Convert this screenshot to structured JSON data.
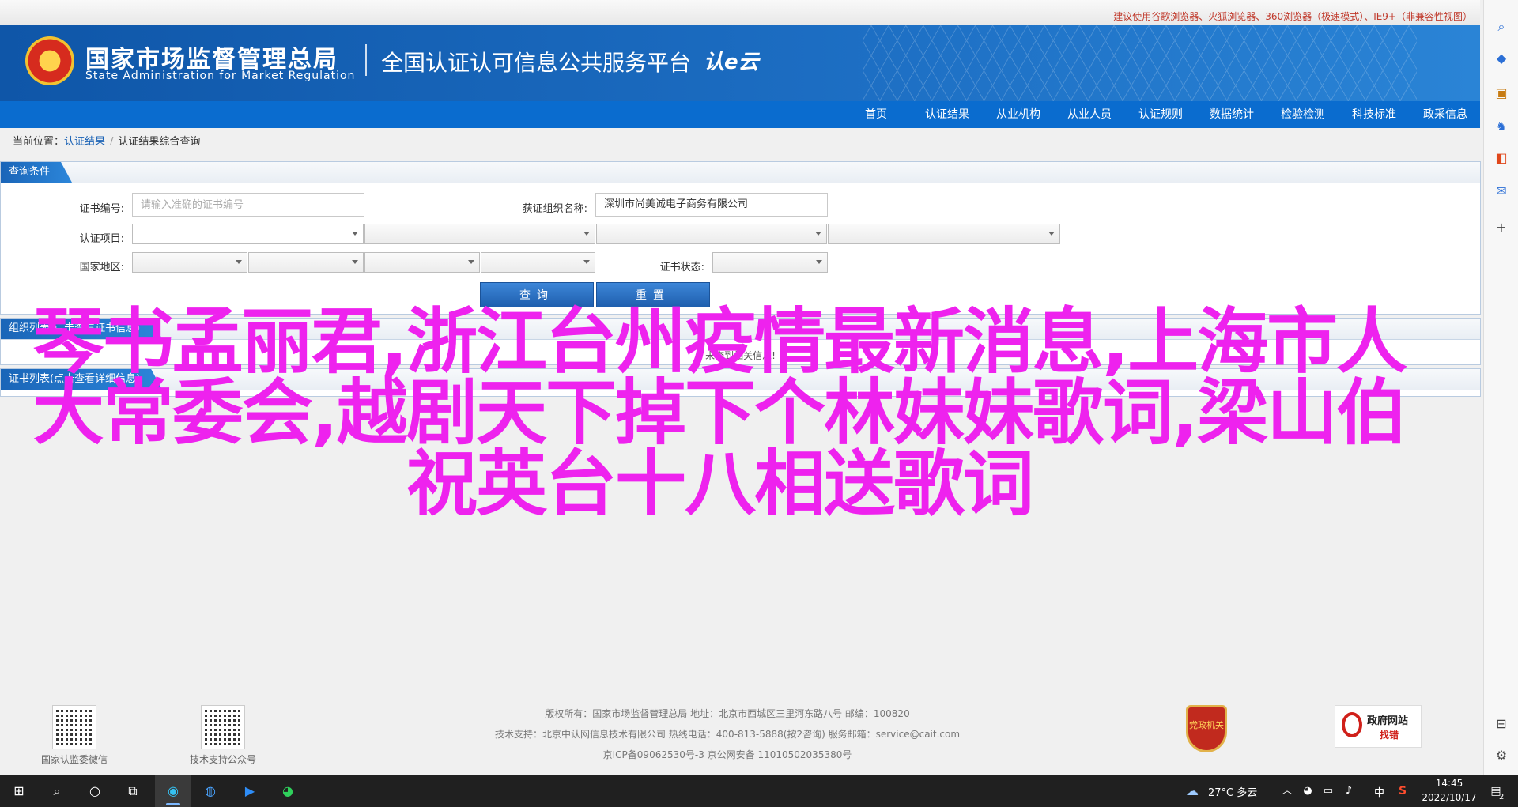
{
  "topbar": {
    "notice": "建议使用谷歌浏览器、火狐浏览器、360浏览器（极速模式）、IE9+（非兼容性视图）"
  },
  "header": {
    "agency_cn": "国家市场监督管理总局",
    "agency_en": "State Administration  for  Market Regulation",
    "platform": "全国认证认可信息公共服务平台",
    "cert_logo": "认e云"
  },
  "nav": {
    "items": [
      "首页",
      "认证结果",
      "从业机构",
      "从业人员",
      "认证规则",
      "数据统计",
      "检验检测",
      "科技标准",
      "政采信息"
    ]
  },
  "breadcrumb": {
    "label": "当前位置：",
    "link": "认证结果",
    "sep": "/",
    "current": "认证结果综合查询"
  },
  "query": {
    "tab": "查询条件",
    "cert_no_label": "证书编号:",
    "cert_no_placeholder": "请输入准确的证书编号",
    "org_label": "获证组织名称:",
    "org_value": "深圳市尚美诚电子商务有限公司",
    "project_label": "认证项目:",
    "region_label": "国家地区:",
    "status_label": "证书状态:",
    "search_button": "查询",
    "reset_button": "重置"
  },
  "org_list": {
    "tab": "组织列表(点击查看证书信息)",
    "empty": "未查到相关信息!"
  },
  "cert_list": {
    "tab": "证书列表(点击查看详细信息)"
  },
  "overlay": {
    "text": "琴书孟丽君,浙江台州疫情最新消息,上海市人大常委会,越剧天下掉下个林妹妹歌词,梁山伯祝英台十八相送歌词"
  },
  "footer": {
    "qr1_caption": "国家认监委微信",
    "qr2_caption": "技术支持公众号",
    "line1": "版权所有：国家市场监督管理总局    地址：北京市西城区三里河东路八号    邮编：100820",
    "line2": "技术支持：北京中认网信息技术有限公司    热线电话：400-813-5888(按2咨询)    服务邮箱：service@cait.com",
    "line3": "京ICP备09062530号-3      京公网安备 11010502035380号",
    "party_badge": "党政机关",
    "gov_badge_t1": "政府网站",
    "gov_badge_t2": "找错"
  },
  "sidebar": {
    "icons": [
      "search-icon",
      "tag-icon",
      "briefcase-icon",
      "games-icon",
      "office-icon",
      "outlook-icon",
      "add-icon",
      "split-view-icon",
      "settings-icon"
    ]
  },
  "taskbar": {
    "weather": "27°C  多云",
    "ime": "中",
    "time": "14:45",
    "date": "2022/10/17",
    "notification_count": "2"
  }
}
